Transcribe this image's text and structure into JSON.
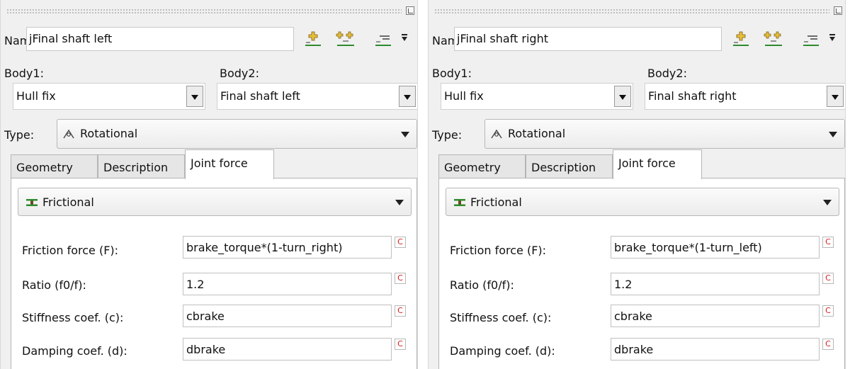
{
  "colors": {
    "panel_bg": "#f0f0f0",
    "c_button_text": "#d21e1e",
    "frictional_icon": "#2e8b2e"
  },
  "panels": [
    {
      "name_label": "Name",
      "name_value": "jFinal shaft left",
      "body1_label": "Body1:",
      "body1_value": "Hull fix",
      "body2_label": "Body2:",
      "body2_value": "Final shaft left",
      "type_label": "Type:",
      "type_value": "Rotational",
      "tabs": [
        "Geometry",
        "Description",
        "Joint force"
      ],
      "active_tab": "Joint force",
      "force_type": "Frictional",
      "params": [
        {
          "label": "Friction force (F):",
          "value": "brake_torque*(1-turn_right)",
          "c": "C"
        },
        {
          "label": "Ratio (f0/f):",
          "value": "1.2",
          "c": "C"
        },
        {
          "label": "Stiffness coef. (c):",
          "value": "cbrake",
          "c": "C"
        },
        {
          "label": "Damping coef. (d):",
          "value": "dbrake",
          "c": "C"
        }
      ]
    },
    {
      "name_label": "Name",
      "name_value": "jFinal shaft right",
      "body1_label": "Body1:",
      "body1_value": "Hull fix",
      "body2_label": "Body2:",
      "body2_value": "Final shaft right",
      "type_label": "Type:",
      "type_value": "Rotational",
      "tabs": [
        "Geometry",
        "Description",
        "Joint force"
      ],
      "active_tab": "Joint force",
      "force_type": "Frictional",
      "params": [
        {
          "label": "Friction force (F):",
          "value": "brake_torque*(1-turn_left)",
          "c": "C"
        },
        {
          "label": "Ratio (f0/f):",
          "value": "1.2",
          "c": "C"
        },
        {
          "label": "Stiffness coef. (c):",
          "value": "cbrake",
          "c": "C"
        },
        {
          "label": "Damping coef. (d):",
          "value": "dbrake",
          "c": "C"
        }
      ]
    }
  ]
}
